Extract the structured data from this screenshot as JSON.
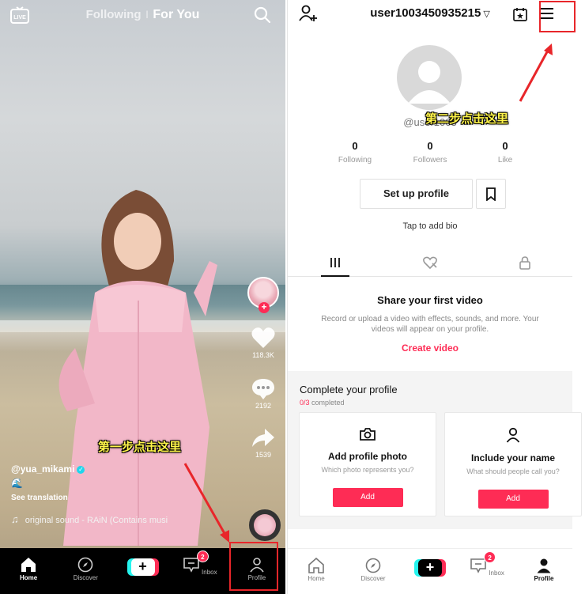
{
  "feed": {
    "live_label": "LIVE",
    "tab_following": "Following",
    "tab_separator": "|",
    "tab_foryou": "For You",
    "likes": "118.3K",
    "comments": "2192",
    "shares": "1539",
    "caption_username": "@yua_mikami",
    "caption_emoji": "🌊",
    "see_translation": "See translation",
    "sound": "original sound - RAiN (Contains musi"
  },
  "annotations": {
    "step1": "第一步点击这里",
    "step2": "第二步点击这里"
  },
  "nav": {
    "home": "Home",
    "discover": "Discover",
    "inbox": "Inbox",
    "profile": "Profile",
    "inbox_badge": "2",
    "create": "+"
  },
  "profile": {
    "username": "user1003450935215",
    "handle": "@user1003",
    "stats": [
      {
        "value": "0",
        "label": "Following"
      },
      {
        "value": "0",
        "label": "Followers"
      },
      {
        "value": "0",
        "label": "Like"
      }
    ],
    "setup_button": "Set up profile",
    "bio_prompt": "Tap to add bio",
    "share_title": "Share your first video",
    "share_desc": "Record or upload a video with effects, sounds, and more. Your videos will appear on your profile.",
    "create_video": "Create video",
    "complete_title": "Complete your profile",
    "progress_done": "0/3",
    "progress_label": " completed",
    "cards": [
      {
        "title": "Add profile photo",
        "desc": "Which photo represents you?",
        "button": "Add"
      },
      {
        "title": "Include your name",
        "desc": "What should people call you?",
        "button": "Add"
      }
    ]
  },
  "colors": {
    "accent": "#fe2c55",
    "annotation_box": "#e8262a",
    "annotation_text": "#fff54a"
  }
}
